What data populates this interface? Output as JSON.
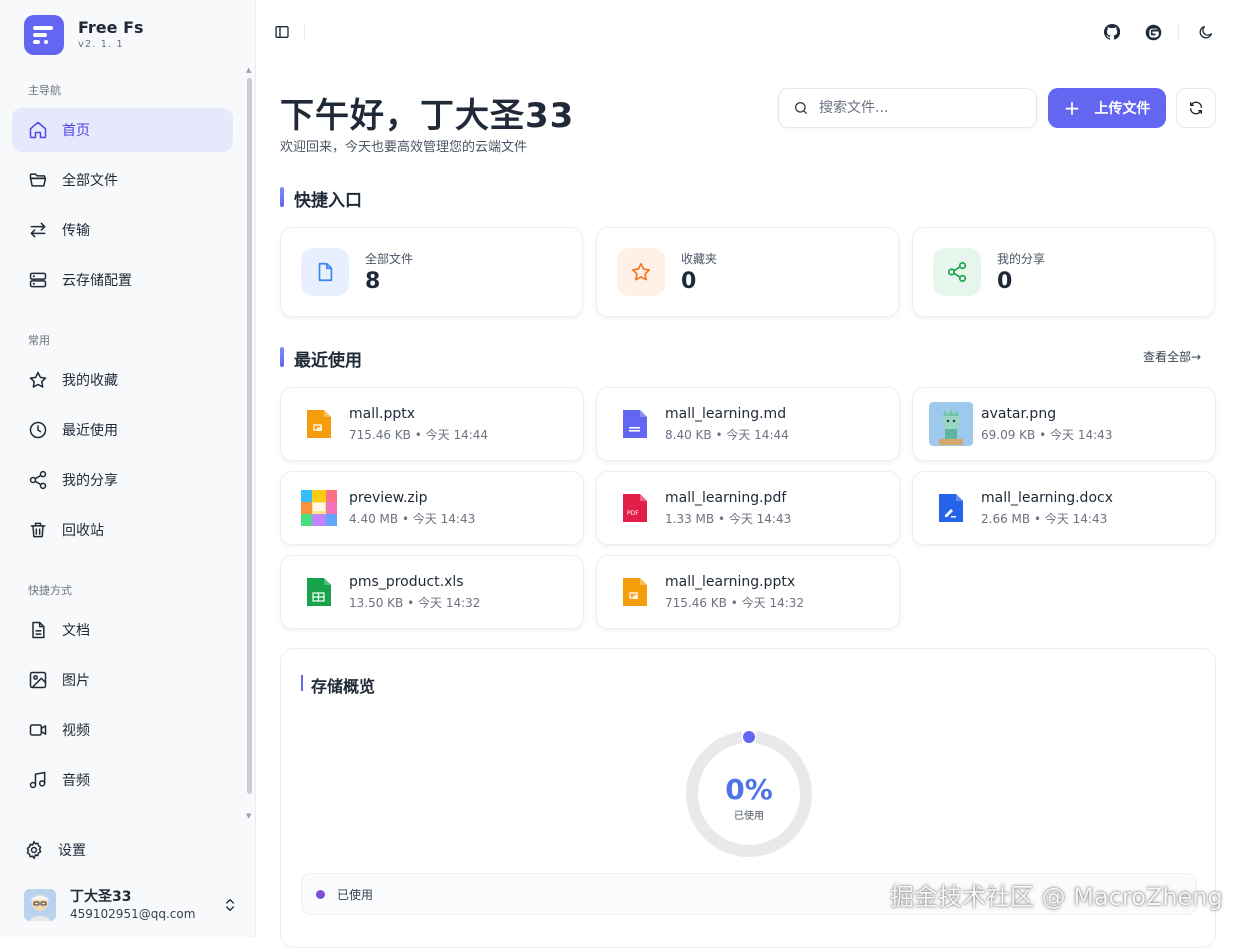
{
  "app": {
    "name": "Free Fs",
    "version": "v2. 1. 1"
  },
  "sidebar": {
    "sections": [
      {
        "label": "主导航",
        "items": [
          {
            "label": "首页",
            "icon": "home-icon",
            "active": true
          },
          {
            "label": "全部文件",
            "icon": "folder-icon"
          },
          {
            "label": "传输",
            "icon": "transfer-icon"
          },
          {
            "label": "云存储配置",
            "icon": "server-icon"
          }
        ]
      },
      {
        "label": "常用",
        "items": [
          {
            "label": "我的收藏",
            "icon": "star-icon"
          },
          {
            "label": "最近使用",
            "icon": "clock-icon"
          },
          {
            "label": "我的分享",
            "icon": "share-icon"
          },
          {
            "label": "回收站",
            "icon": "trash-icon"
          }
        ]
      },
      {
        "label": "快捷方式",
        "items": [
          {
            "label": "文档",
            "icon": "document-icon"
          },
          {
            "label": "图片",
            "icon": "image-icon"
          },
          {
            "label": "视频",
            "icon": "video-icon"
          },
          {
            "label": "音频",
            "icon": "music-icon"
          }
        ]
      }
    ],
    "settings_label": "设置",
    "user": {
      "name": "丁大圣33",
      "email": "459102951@qq.com"
    }
  },
  "header": {
    "greeting": "下午好，丁大圣33",
    "subtitle": "欢迎回来，今天也要高效管理您的云端文件",
    "search_placeholder": "搜索文件...",
    "upload_label": "上传文件"
  },
  "quick_access": {
    "title": "快捷入口",
    "cards": [
      {
        "label": "全部文件",
        "count": "8",
        "icon": "file-icon",
        "color": "#3b82f6"
      },
      {
        "label": "收藏夹",
        "count": "0",
        "icon": "star-icon",
        "color": "#f97316"
      },
      {
        "label": "我的分享",
        "count": "0",
        "icon": "share-icon",
        "color": "#16a34a"
      }
    ]
  },
  "recent": {
    "title": "最近使用",
    "view_all": "查看全部→",
    "files": [
      {
        "name": "mall.pptx",
        "size": "715.46 KB",
        "time": "今天 14:44",
        "type": "pptx"
      },
      {
        "name": "mall_learning.md",
        "size": "8.40 KB",
        "time": "今天 14:44",
        "type": "md"
      },
      {
        "name": "avatar.png",
        "size": "69.09 KB",
        "time": "今天 14:43",
        "type": "png"
      },
      {
        "name": "preview.zip",
        "size": "4.40 MB",
        "time": "今天 14:43",
        "type": "zip"
      },
      {
        "name": "mall_learning.pdf",
        "size": "1.33 MB",
        "time": "今天 14:43",
        "type": "pdf"
      },
      {
        "name": "mall_learning.docx",
        "size": "2.66 MB",
        "time": "今天 14:43",
        "type": "docx"
      },
      {
        "name": "pms_product.xls",
        "size": "13.50 KB",
        "time": "今天 14:32",
        "type": "xls"
      },
      {
        "name": "mall_learning.pptx",
        "size": "715.46 KB",
        "time": "今天 14:32",
        "type": "pptx"
      }
    ]
  },
  "storage": {
    "title": "存储概览",
    "percent": "0%",
    "percent_label": "已使用",
    "used_fraction": 0,
    "used_row_label": "已使用"
  },
  "watermark": "掘金技术社区 @ MacroZheng",
  "colors": {
    "accent": "#6366f1",
    "sidebar_bg": "#f8f9fb"
  }
}
